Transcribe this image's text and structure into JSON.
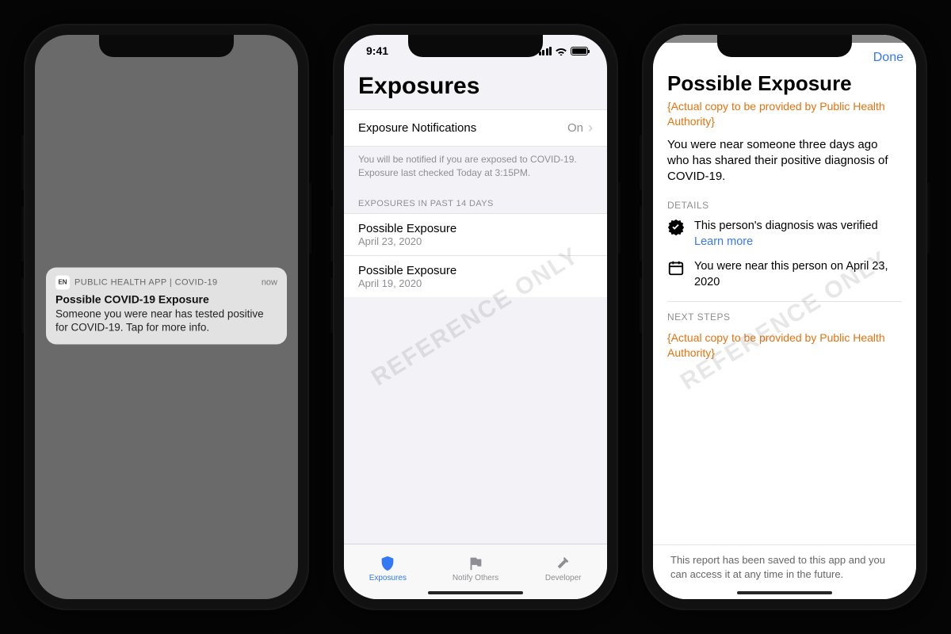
{
  "watermark": "REFERENCE ONLY",
  "statusbar": {
    "time": "9:41"
  },
  "phone1": {
    "notification": {
      "app_icon_text": "EN",
      "app_name": "PUBLIC HEALTH APP | COVID-19",
      "time": "now",
      "title": "Possible COVID-19 Exposure",
      "body": "Someone you were near has tested positive for COVID-19. Tap for more info."
    }
  },
  "phone2": {
    "page_title": "Exposures",
    "settings_row": {
      "label": "Exposure Notifications",
      "value": "On"
    },
    "description": "You will be notified if you are exposed to COVID-19. Exposure last checked Today at 3:15PM.",
    "section_header": "EXPOSURES IN PAST 14 DAYS",
    "exposures": [
      {
        "title": "Possible Exposure",
        "date": "April 23, 2020"
      },
      {
        "title": "Possible Exposure",
        "date": "April 19, 2020"
      }
    ],
    "tabs": {
      "exposures": "Exposures",
      "notify": "Notify Others",
      "developer": "Developer"
    }
  },
  "phone3": {
    "done": "Done",
    "title": "Possible Exposure",
    "placeholder1": "{Actual copy to be provided by Public Health Authority}",
    "body": "You were near someone three days ago who has shared their positive diagnosis of COVID-19.",
    "details_header": "DETAILS",
    "detail1": "This person's diagnosis was verified",
    "learn_more": "Learn more",
    "detail2": "You were near this person on April 23, 2020",
    "next_steps_header": "NEXT STEPS",
    "placeholder2": "{Actual copy to be provided by Public Health Authority}",
    "footer": "This report has been saved to this app and you can access it at any time in the future."
  }
}
